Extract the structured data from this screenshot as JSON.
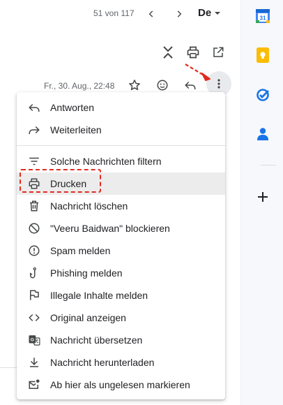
{
  "topbar": {
    "count": "51 von 117",
    "lang": "De"
  },
  "message": {
    "date": "Fr., 30. Aug., 22:48"
  },
  "menu": {
    "items": [
      {
        "label": "Antworten"
      },
      {
        "label": "Weiterleiten"
      },
      {
        "label": "Solche Nachrichten filtern"
      },
      {
        "label": "Drucken"
      },
      {
        "label": "Nachricht löschen"
      },
      {
        "label": "\"Veeru Baidwan\" blockieren"
      },
      {
        "label": "Spam melden"
      },
      {
        "label": "Phishing melden"
      },
      {
        "label": "Illegale Inhalte melden"
      },
      {
        "label": "Original anzeigen"
      },
      {
        "label": "Nachricht übersetzen"
      },
      {
        "label": "Nachricht herunterladen"
      },
      {
        "label": "Ab hier als ungelesen markieren"
      }
    ],
    "highlighted": "Drucken"
  },
  "rail": {
    "calendar_day": "31"
  },
  "colors": {
    "annotation": "#e02b20",
    "highlight": "#ececec",
    "icon": "#444746"
  }
}
